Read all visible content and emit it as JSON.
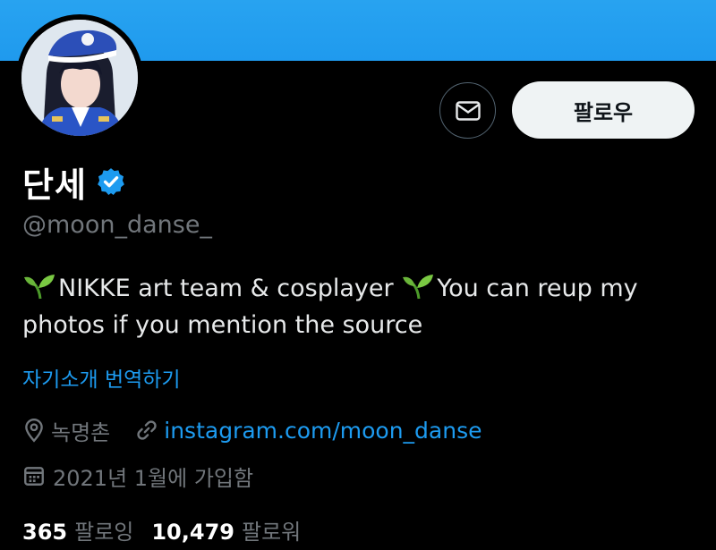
{
  "header": {
    "banner_color": "#1d9bf0"
  },
  "profile": {
    "display_name": "단세",
    "verified_icon": "verified-badge-icon",
    "handle": "@moon_danse_",
    "bio_part1": "NIKKE art team & cosplayer ",
    "bio_part2": "You can reup my photos if you mention the source",
    "translate_label": "자기소개 번역하기",
    "location": "녹명촌",
    "website": "instagram.com/moon_danse",
    "joined": "2021년 1월에 가입함",
    "following_count": "365",
    "following_label": "팔로잉",
    "followers_count": "10,479",
    "followers_label": "팔로워"
  },
  "actions": {
    "message_icon": "envelope-icon",
    "follow_label": "팔로우"
  },
  "colors": {
    "accent": "#1d9bf0",
    "background": "#000000",
    "muted_text": "#71767b",
    "verified": "#1d9bf0"
  }
}
